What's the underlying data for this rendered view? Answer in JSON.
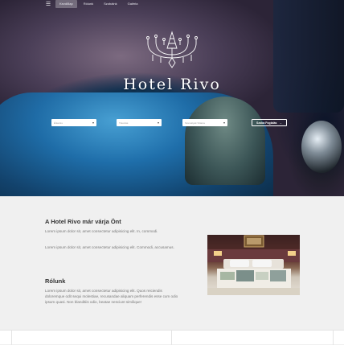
{
  "nav": {
    "menu_icon": "hamburger-icon",
    "items": [
      {
        "label": "Kezdőlap",
        "active": true
      },
      {
        "label": "Rólunk",
        "active": false
      },
      {
        "label": "Szobáink",
        "active": false
      },
      {
        "label": "Galéria",
        "active": false
      }
    ]
  },
  "hero": {
    "logo_icon": "chandelier-icon",
    "title": "Hotel Rivo",
    "search": {
      "field_1": "Érkezés",
      "field_2": "Távozás",
      "field_3": "Személyek Száma",
      "button_label": "Szoba Foglalás",
      "button_icon": "arrow-right-icon"
    }
  },
  "welcome": {
    "heading": "A Hotel Rivo már várja Önt",
    "p1": "Lorem ipsum dolor sit, amet consectetur adipisicing elit. In, commodi.",
    "p2": "Lorem ipsum dolor sit, amet consectetur adipisicing elit. Commodi, accusamus."
  },
  "about": {
    "heading": "Rólunk",
    "p1": "Lorem ipsum dolor sit, amet consectetur adipisicing elit. Quos reiciendis doloremque odit sequi molestiae, recusandae aliquam perferendis esse cum odio ipsum quasi. Non blanditiis odio, beatae nesciunt similique!"
  },
  "colors": {
    "background": "#f0f0f0",
    "heading": "#333333",
    "text": "#777777",
    "hero_accent": "#2d88c4"
  }
}
